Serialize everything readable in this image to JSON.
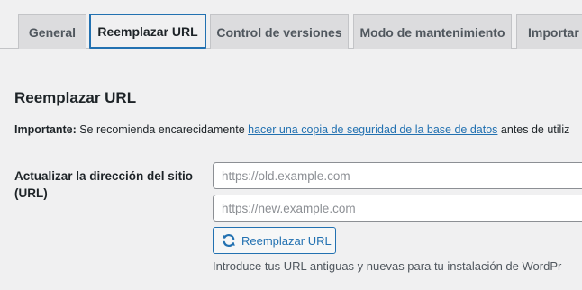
{
  "tabs": [
    {
      "label": "General",
      "active": false
    },
    {
      "label": "Reemplazar URL",
      "active": true
    },
    {
      "label": "Control de versiones",
      "active": false
    },
    {
      "label": "Modo de mantenimiento",
      "active": false
    },
    {
      "label": "Importar /",
      "active": false
    }
  ],
  "section": {
    "title": "Reemplazar URL"
  },
  "notice": {
    "strong": "Importante:",
    "before_link": " Se recomienda encarecidamente ",
    "link": "hacer una copia de seguridad de la base de datos",
    "after_link": " antes de utiliz"
  },
  "form": {
    "label": "Actualizar la dirección del sitio (URL)",
    "old_placeholder": "https://old.example.com",
    "new_placeholder": "https://new.example.com",
    "button_label": "Reemplazar URL",
    "button_icon": "refresh-icon",
    "help": "Introduce tus URL antiguas y nuevas para tu instalación de WordPr"
  },
  "colors": {
    "accent": "#2271b1",
    "background": "#f0f0f1",
    "tab_inactive": "#dcdcde"
  }
}
